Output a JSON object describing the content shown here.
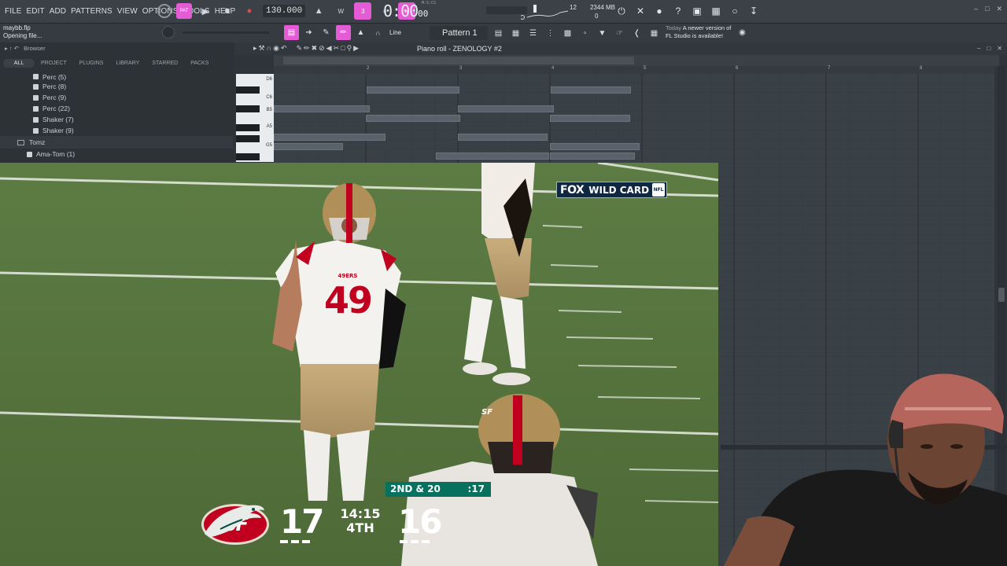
{
  "menu": [
    "FILE",
    "EDIT",
    "ADD",
    "PATTERNS",
    "VIEW",
    "OPTIONS",
    "TOOLS",
    "HELP"
  ],
  "transport": {
    "mode_label": "PAT",
    "tempo": "130.000",
    "time_main": "0:00",
    "time_sub": "00",
    "time_unit": "M:S:CS"
  },
  "status": {
    "cpu_count": "12",
    "memory": "2344 MB",
    "polyphony": "0"
  },
  "file": {
    "name": "maybb.flp",
    "hint": "Opening file..."
  },
  "toolbar2": {
    "snap_label": "Line",
    "pattern_label": "Pattern 1"
  },
  "news": {
    "today": "Today",
    "line1": "A newer version of",
    "line2": "FL Studio is available!"
  },
  "browser": {
    "title": "Browser",
    "tabs": [
      "ALL",
      "PROJECT",
      "PLUGINS",
      "LIBRARY",
      "STARRED",
      "PACKS"
    ],
    "items": [
      {
        "label": "Perc (5)",
        "type": "file"
      },
      {
        "label": "Perc (8)",
        "type": "file"
      },
      {
        "label": "Perc (9)",
        "type": "file"
      },
      {
        "label": "Perc (22)",
        "type": "file"
      },
      {
        "label": "Shaker (7)",
        "type": "file"
      },
      {
        "label": "Shaker (9)",
        "type": "file"
      },
      {
        "label": "Tomz",
        "type": "folder"
      },
      {
        "label": "Ama-Tom (1)",
        "type": "file"
      }
    ]
  },
  "piano_roll": {
    "title": "Piano roll - ZENOLOGY #2",
    "bars": [
      "2",
      "3",
      "4",
      "5",
      "6",
      "7",
      "8"
    ],
    "keys": [
      "D6",
      "C6",
      "B5",
      "A5",
      "G5"
    ]
  },
  "broadcast": {
    "network": "FOX",
    "event": "WILD CARD",
    "league": "NFL",
    "home_logo": "SF",
    "home_score": "17",
    "away_score": "16",
    "game_clock": "14:15",
    "quarter": "4TH",
    "down_distance": "2ND & 20",
    "play_clock": ":17",
    "jersey_number": "49",
    "jersey_wordmark": "49ERS",
    "helmet_logo": "SF"
  },
  "colors": {
    "accent": "#e55bd6",
    "toolbar": "#3b4146",
    "record": "#e24b4b",
    "field": "#5c7a43",
    "niners_red": "#c1001f",
    "scorebug_teal": "#06715f"
  }
}
